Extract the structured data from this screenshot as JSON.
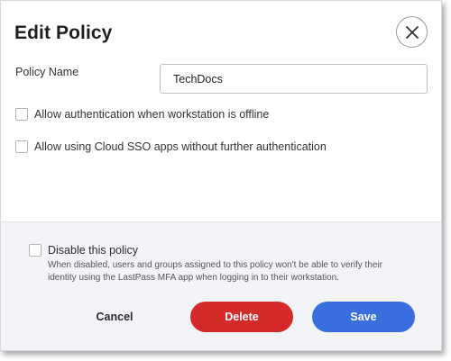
{
  "dialog": {
    "title": "Edit Policy",
    "close_icon": "close-icon"
  },
  "form": {
    "policy_name_label": "Policy Name",
    "policy_name_value": "TechDocs",
    "options": [
      {
        "label": "Allow authentication when workstation is offline",
        "checked": false
      },
      {
        "label": "Allow using Cloud SSO apps without further authentication",
        "checked": false
      }
    ]
  },
  "footer": {
    "disable_label": "Disable this policy",
    "disable_checked": false,
    "disable_description": "When disabled, users and groups assigned to this policy won't be able to verify their identity using the LastPass MFA app when logging in to their workstation.",
    "cancel_label": "Cancel",
    "delete_label": "Delete",
    "save_label": "Save"
  },
  "colors": {
    "delete": "#d42a2a",
    "save": "#3a6ede",
    "footer_bg": "#f3f4f8"
  }
}
